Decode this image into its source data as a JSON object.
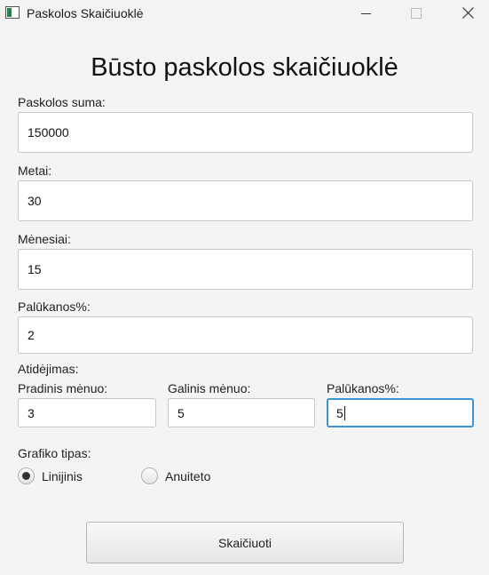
{
  "window": {
    "title": "Paskolos Skaičiuoklė"
  },
  "heading": "Būsto paskolos skaičiuoklė",
  "fields": {
    "loan_amount": {
      "label": "Paskolos suma:",
      "value": "150000"
    },
    "years": {
      "label": "Metai:",
      "value": "30"
    },
    "months": {
      "label": "Mėnesiai:",
      "value": "15"
    },
    "interest": {
      "label": "Palūkanos%:",
      "value": "2"
    }
  },
  "deferral": {
    "label": "Atidėjimas:",
    "start_month": {
      "label": "Pradinis mėnuo:",
      "value": "3"
    },
    "end_month": {
      "label": "Galinis mėnuo:",
      "value": "5"
    },
    "interest": {
      "label": "Palūkanos%:",
      "value": "5"
    }
  },
  "chart_type": {
    "label": "Grafiko tipas:",
    "options": [
      {
        "label": "Linijinis",
        "checked": true
      },
      {
        "label": "Anuiteto",
        "checked": false
      }
    ]
  },
  "calculate_label": "Skaičiuoti",
  "colors": {
    "focus_border": "#3a93d6",
    "background": "#f4f4f4"
  }
}
